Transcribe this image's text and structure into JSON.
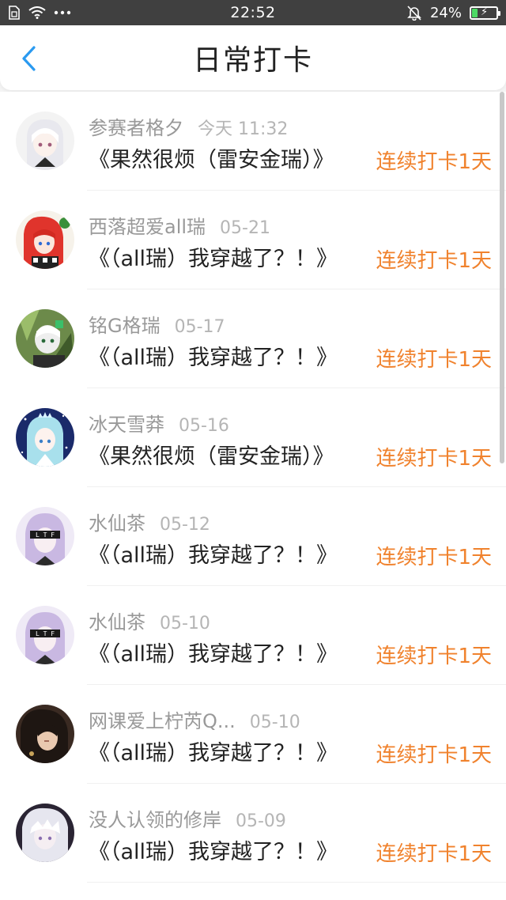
{
  "status_bar": {
    "time": "22:52",
    "battery_percent": "24%",
    "battery_level": 0.24,
    "icons": [
      "sim-card-icon",
      "wifi-icon",
      "more-dots-icon",
      "bell-off-icon",
      "battery-charging-icon"
    ]
  },
  "header": {
    "title": "日常打卡",
    "back_icon": "chevron-left-icon",
    "accent_color": "#2a9af0"
  },
  "list": {
    "items": [
      {
        "user": "参赛者格夕",
        "date": "今天 11:32",
        "book": "《果然很烦（雷安金瑞）》",
        "streak": "连续打卡1天"
      },
      {
        "user": "西落超爱all瑞",
        "date": "05-21",
        "book": "《（all瑞）我穿越了？！》",
        "streak": "连续打卡1天"
      },
      {
        "user": "铭G格瑞",
        "date": "05-17",
        "book": "《（all瑞）我穿越了？！》",
        "streak": "连续打卡1天"
      },
      {
        "user": "冰天雪莽",
        "date": "05-16",
        "book": "《果然很烦（雷安金瑞）》",
        "streak": "连续打卡1天"
      },
      {
        "user": "水仙茶",
        "date": "05-12",
        "book": "《（all瑞）我穿越了？！》",
        "streak": "连续打卡1天"
      },
      {
        "user": "水仙茶",
        "date": "05-10",
        "book": "《（all瑞）我穿越了？！》",
        "streak": "连续打卡1天"
      },
      {
        "user": "网课爱上柠芮Q...",
        "date": "05-10",
        "book": "《（all瑞）我穿越了？！》",
        "streak": "连续打卡1天"
      },
      {
        "user": "没人认领的修岸",
        "date": "05-09",
        "book": "《（all瑞）我穿越了？！》",
        "streak": "连续打卡1天"
      }
    ]
  },
  "colors": {
    "streak": "#f0822d",
    "username": "#999999",
    "date": "#b5b5b5",
    "status_bar_bg": "#404040",
    "battery_green": "#4cd964"
  }
}
